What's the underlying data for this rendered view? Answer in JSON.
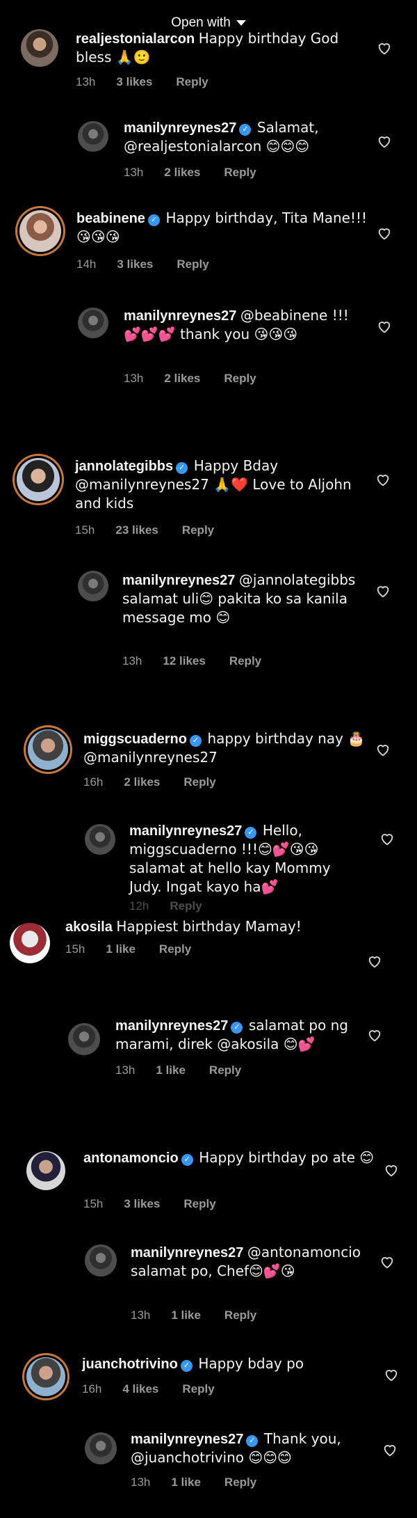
{
  "header": {
    "open_with": "Open with"
  },
  "comments": [
    {
      "user": "realjestonialarcon",
      "text": "Happy birthday God bless 🙏🙂",
      "time": "13h",
      "likes": "3 likes",
      "reply": "Reply",
      "verified": false
    },
    {
      "user": "manilynreynes27",
      "text": "Salamat, @realjestonialarcon 😊😊😊",
      "time": "13h",
      "likes": "2 likes",
      "reply": "Reply",
      "verified": true
    },
    {
      "user": "beabinene",
      "text": "Happy birthday, Tita Mane!!! 😘😘😘",
      "time": "14h",
      "likes": "3 likes",
      "reply": "Reply",
      "verified": true
    },
    {
      "user": "manilynreynes27",
      "text": "@beabinene !!!💕💕💕 thank you 😘😘😘",
      "time": "13h",
      "likes": "2 likes",
      "reply": "Reply",
      "verified": false
    },
    {
      "user": "jannolategibbs",
      "text": "Happy Bday @manilynreynes27 🙏❤️ Love to Aljohn and kids",
      "time": "15h",
      "likes": "23 likes",
      "reply": "Reply",
      "verified": true
    },
    {
      "user": "manilynreynes27",
      "text": "@jannolategibbs salamat uli😊 pakita ko sa kanila message mo 😊",
      "time": "13h",
      "likes": "12 likes",
      "reply": "Reply",
      "verified": false
    },
    {
      "user": "miggscuaderno",
      "text": "happy birthday nay 🎂 @manilynreynes27",
      "time": "16h",
      "likes": "2 likes",
      "reply": "Reply",
      "verified": true
    },
    {
      "user": "manilynreynes27",
      "text": "Hello, miggscuaderno !!!😊💕😘😘 salamat at hello kay Mommy Judy. Ingat kayo ha💕",
      "time": "12h",
      "likes": "",
      "reply": "Reply",
      "verified": true
    },
    {
      "user": "akosila",
      "text": "Happiest birthday Mamay!",
      "time": "15h",
      "likes": "1 like",
      "reply": "Reply",
      "verified": false
    },
    {
      "user": "manilynreynes27",
      "text": "salamat po ng marami,  direk @akosila 😊💕",
      "time": "13h",
      "likes": "1 like",
      "reply": "Reply",
      "verified": true
    },
    {
      "user": "antonamoncio",
      "text": "Happy birthday po ate 😊",
      "time": "15h",
      "likes": "3 likes",
      "reply": "Reply",
      "verified": true
    },
    {
      "user": "manilynreynes27",
      "text": "@antonamoncio salamat po, Chef😊💕😘",
      "time": "13h",
      "likes": "1 like",
      "reply": "Reply",
      "verified": false
    },
    {
      "user": "juanchotrivino",
      "text": "Happy bday po",
      "time": "16h",
      "likes": "4 likes",
      "reply": "Reply",
      "verified": true
    },
    {
      "user": "manilynreynes27",
      "text": "Thank you, @juanchotrivino 😊😊😊",
      "time": "13h",
      "likes": "1 like",
      "reply": "Reply",
      "verified": true
    }
  ]
}
